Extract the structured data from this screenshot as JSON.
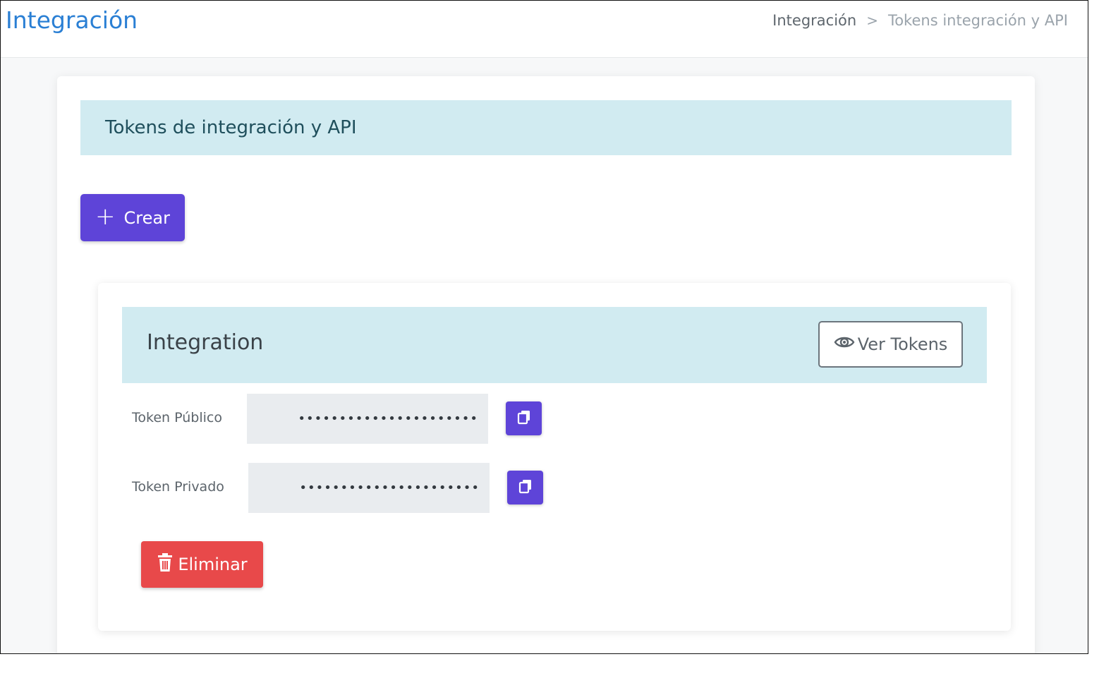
{
  "header": {
    "title": "Integración",
    "breadcrumb": {
      "parent": "Integración",
      "separator": ">",
      "current": "Tokens integración y API"
    }
  },
  "section": {
    "title": "Tokens de integración y API"
  },
  "create_button": {
    "icon": "plus-icon",
    "label": "Crear"
  },
  "integration": {
    "name": "Integration",
    "view_tokens_icon": "eye-icon",
    "view_tokens_label": "Ver Tokens",
    "tokens": [
      {
        "label": "Token Público",
        "value": "••••••••••••••••••••••",
        "copy_icon": "copy-icon"
      },
      {
        "label": "Token Privado",
        "value": "••••••••••••••••••••••",
        "copy_icon": "copy-icon"
      }
    ],
    "delete_icon": "trash-icon",
    "delete_label": "Eliminar"
  },
  "colors": {
    "primary": "#5e44d8",
    "danger": "#e8494a",
    "header_bg": "#d1ebf1",
    "title_blue": "#2a7fd4"
  }
}
